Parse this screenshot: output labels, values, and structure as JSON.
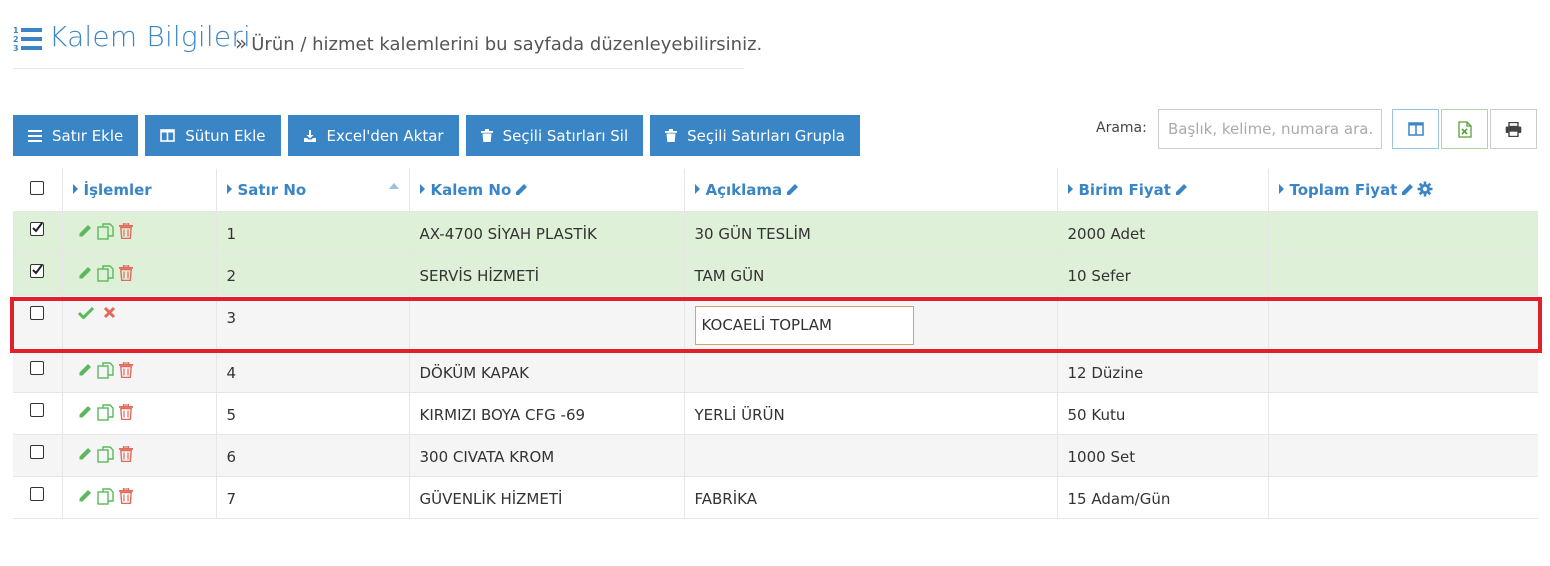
{
  "header": {
    "title": "Kalem Bilgileri",
    "separator": "»",
    "subtitle": "Ürün / hizmet kalemlerini bu sayfada düzenleyebilirsiniz.",
    "icon": "ordered-list-icon"
  },
  "toolbar": {
    "buttons": [
      {
        "label": "Satır Ekle",
        "icon": "bars-icon"
      },
      {
        "label": "Sütun Ekle",
        "icon": "columns-icon"
      },
      {
        "label": "Excel'den Aktar",
        "icon": "download-icon"
      },
      {
        "label": "Seçili Satırları Sil",
        "icon": "trash-icon"
      },
      {
        "label": "Seçili Satırları Grupla",
        "icon": "trash-icon"
      }
    ]
  },
  "search": {
    "label": "Arama:",
    "placeholder": "Başlık, kelime, numara ara..",
    "value": ""
  },
  "icon_buttons": [
    "columns-icon",
    "excel-icon",
    "print-icon"
  ],
  "table": {
    "columns": [
      {
        "label": ""
      },
      {
        "label": "İşlemler"
      },
      {
        "label": "Satır No"
      },
      {
        "label": "Kalem No"
      },
      {
        "label": "Açıklama"
      },
      {
        "label": "Birim Fiyat"
      },
      {
        "label": "Toplam Fiyat"
      }
    ],
    "rows": [
      {
        "checked": true,
        "state": "selected",
        "no": "1",
        "kalem": "AX-4700 SİYAH PLASTİK",
        "aciklama": "30 GÜN TESLİM",
        "birim": "2000 Adet",
        "toplam": ""
      },
      {
        "checked": true,
        "state": "selected",
        "no": "2",
        "kalem": "SERVİS HİZMETİ",
        "aciklama": "TAM GÜN",
        "birim": "10 Sefer",
        "toplam": ""
      },
      {
        "checked": false,
        "state": "editing",
        "no": "3",
        "kalem": "",
        "aciklama": "KOCAELİ TOPLAM",
        "birim": "",
        "toplam": ""
      },
      {
        "checked": false,
        "state": "normal",
        "no": "4",
        "kalem": "DÖKÜM KAPAK",
        "aciklama": "",
        "birim": "12 Düzine",
        "toplam": ""
      },
      {
        "checked": false,
        "state": "normal",
        "no": "5",
        "kalem": "KIRMIZI BOYA CFG -69",
        "aciklama": "YERLİ ÜRÜN",
        "birim": "50 Kutu",
        "toplam": ""
      },
      {
        "checked": false,
        "state": "normal",
        "no": "6",
        "kalem": "300 CIVATA KROM",
        "aciklama": "",
        "birim": "1000 Set",
        "toplam": ""
      },
      {
        "checked": false,
        "state": "normal",
        "no": "7",
        "kalem": "GÜVENLİK HİZMETİ",
        "aciklama": "FABRİKA",
        "birim": "15 Adam/Gün",
        "toplam": ""
      }
    ]
  },
  "colors": {
    "accent": "#3a85c6",
    "selected_row": "#dff0d8",
    "highlight": "#e0202a",
    "edit_green": "#5cb85c",
    "delete_red": "#e36a5a"
  }
}
